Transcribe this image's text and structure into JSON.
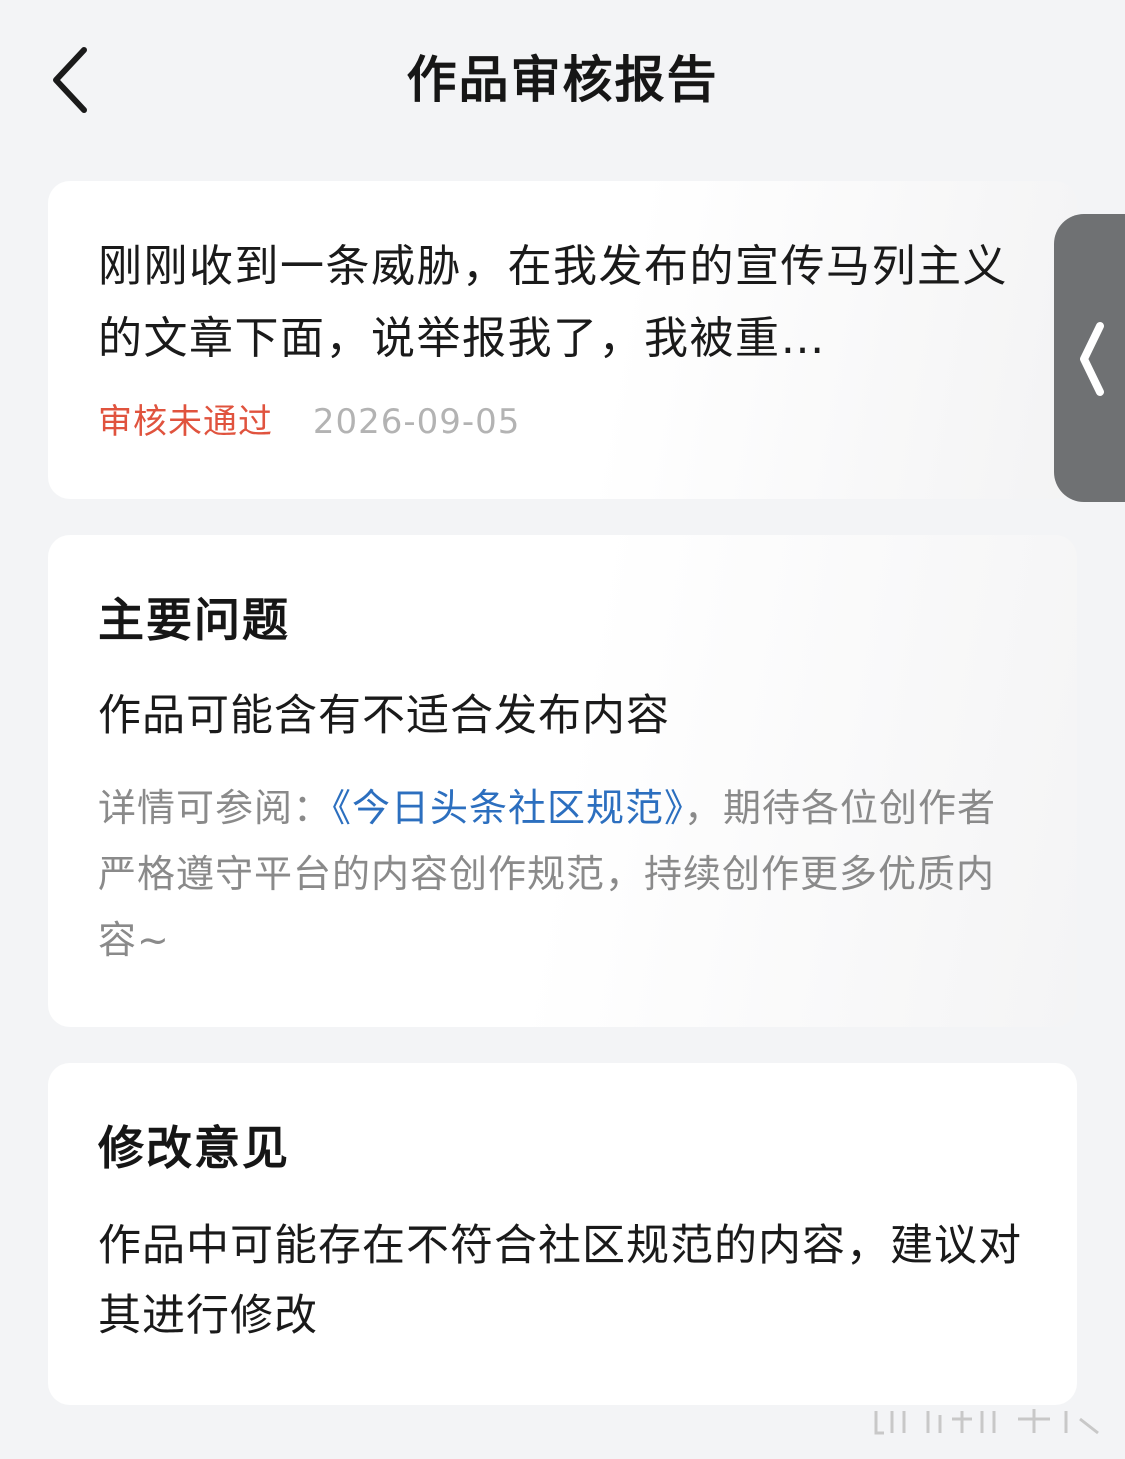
{
  "header": {
    "title": "作品审核报告",
    "back_icon": "chevron-left-icon"
  },
  "article": {
    "summary": "刚刚收到一条威胁，在我发布的宣传马列主义的文章下面，说举报我了，我被重…",
    "status": "审核未通过",
    "status_color": "#e0533e",
    "date": "2026-09-05"
  },
  "problem": {
    "heading": "主要问题",
    "text": "作品可能含有不适合发布内容",
    "detail_prefix": "详情可参阅：",
    "detail_link": "《今日头条社区规范》",
    "detail_suffix": "，期待各位创作者严格遵守平台的内容创作规范，持续创作更多优质内容~",
    "link_color": "#2c6fbf"
  },
  "advice": {
    "heading": "修改意见",
    "text": "作品中可能存在不符合社区规范的内容，建议对其进行修改"
  },
  "side_handle": {
    "icon": "chevron-left-icon"
  }
}
